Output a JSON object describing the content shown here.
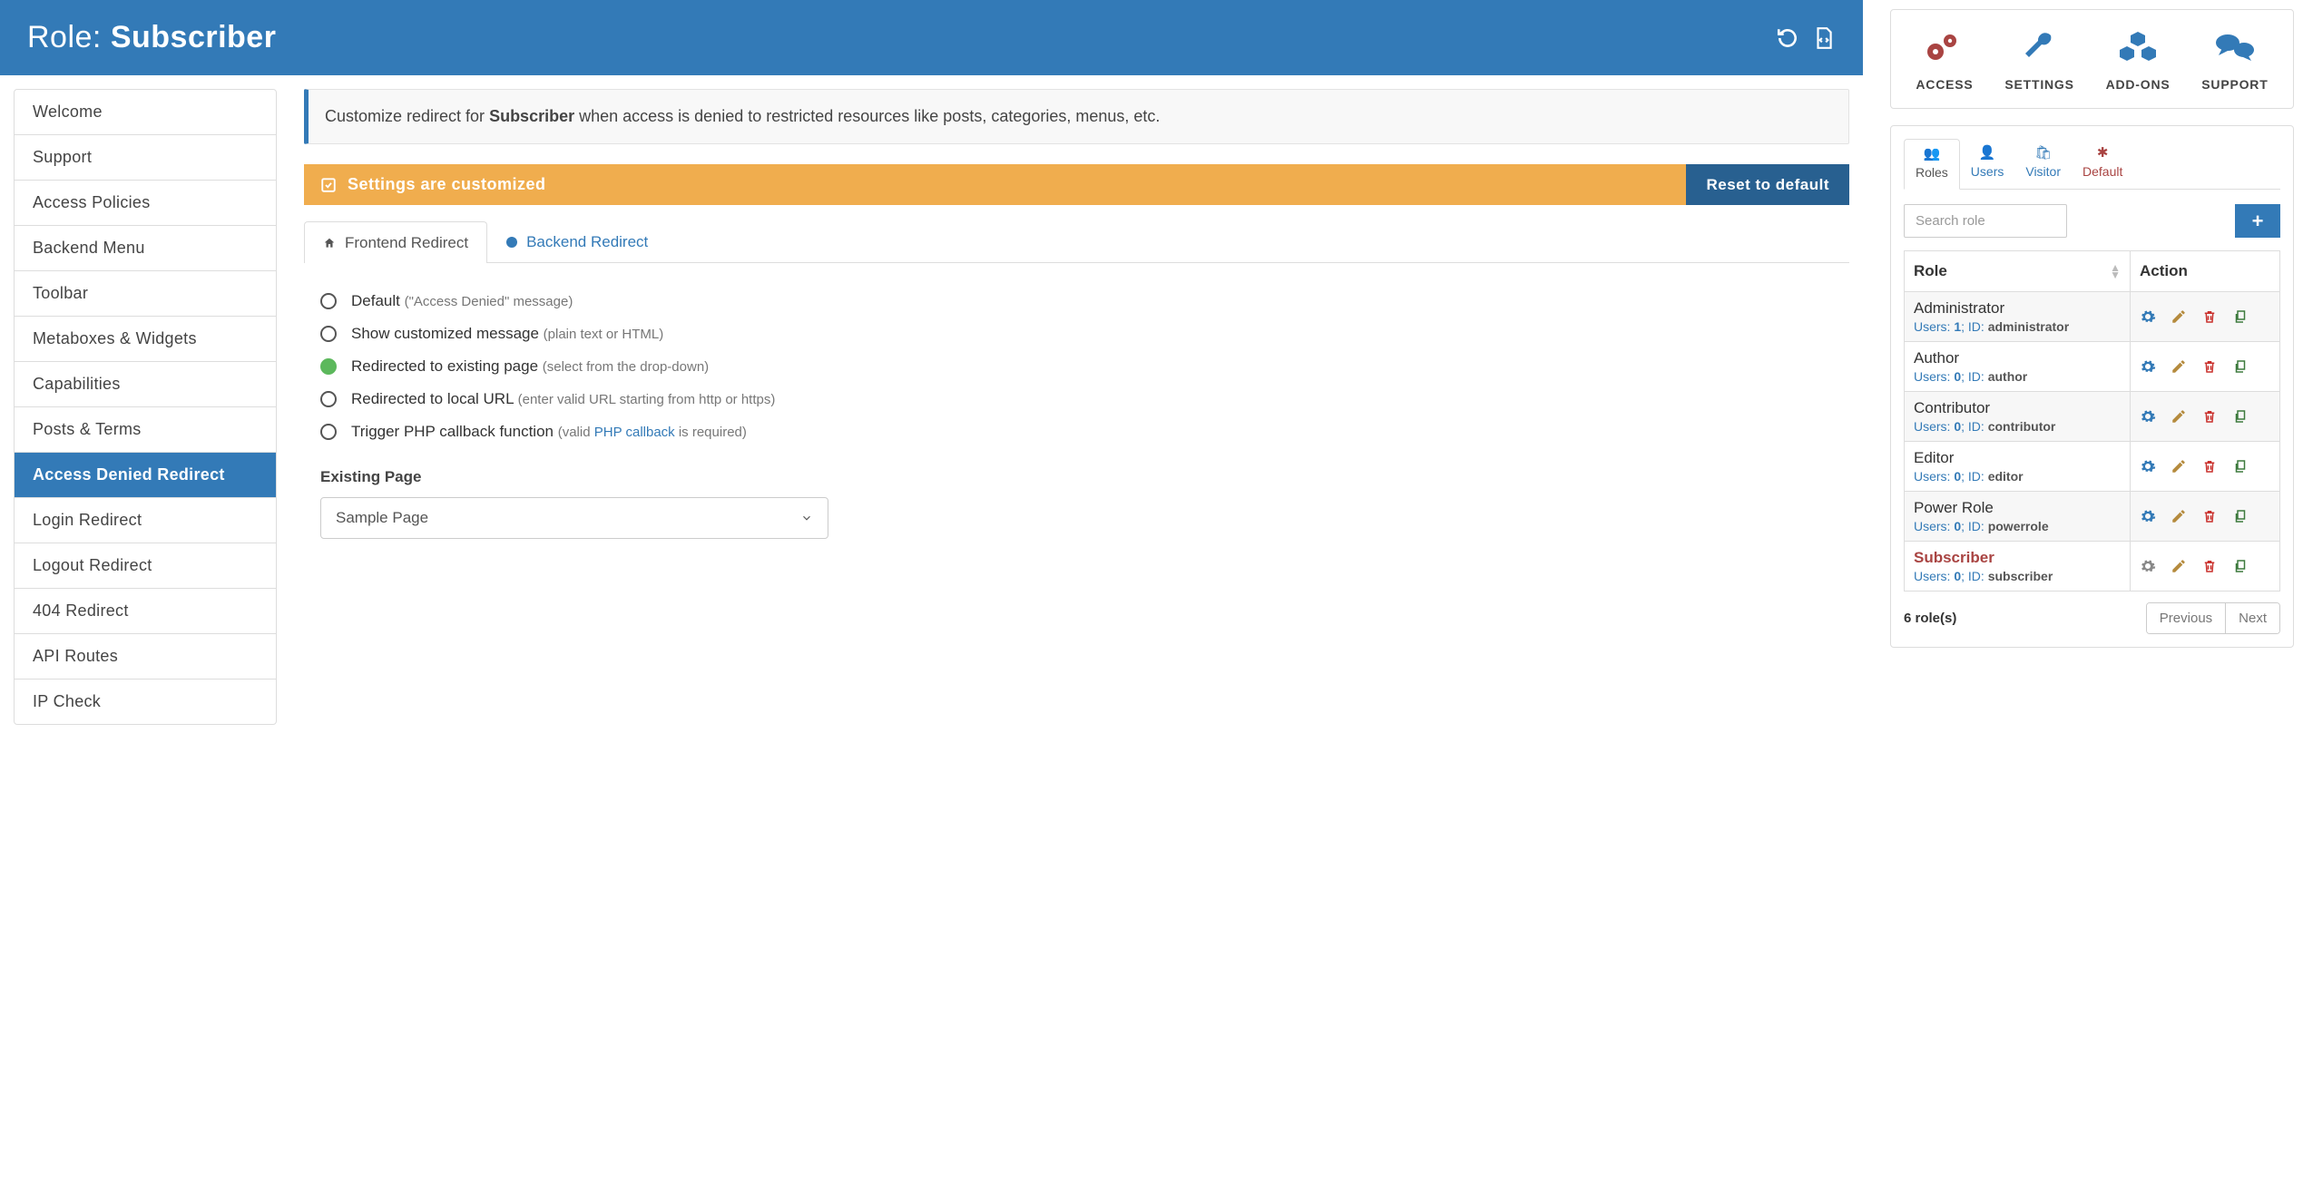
{
  "header": {
    "prefix": "Role:",
    "role": "Subscriber"
  },
  "sidebar": {
    "items": [
      {
        "label": "Welcome"
      },
      {
        "label": "Support"
      },
      {
        "label": "Access Policies"
      },
      {
        "label": "Backend Menu"
      },
      {
        "label": "Toolbar"
      },
      {
        "label": "Metaboxes & Widgets"
      },
      {
        "label": "Capabilities"
      },
      {
        "label": "Posts & Terms"
      },
      {
        "label": "Access Denied Redirect"
      },
      {
        "label": "Login Redirect"
      },
      {
        "label": "Logout Redirect"
      },
      {
        "label": "404 Redirect"
      },
      {
        "label": "API Routes"
      },
      {
        "label": "IP Check"
      }
    ],
    "active_index": 8
  },
  "info": {
    "pre": "Customize redirect for ",
    "role": "Subscriber",
    "post": " when access is denied to restricted resources like posts, categories, menus, etc."
  },
  "custom_bar": {
    "text": "Settings are customized",
    "reset": "Reset to default"
  },
  "tabs": {
    "frontend": "Frontend Redirect",
    "backend": "Backend Redirect"
  },
  "radios": {
    "opt0": {
      "label": "Default ",
      "hint": "(\"Access Denied\" message)"
    },
    "opt1": {
      "label": "Show customized message ",
      "hint": "(plain text or HTML)"
    },
    "opt2": {
      "label": "Redirected to existing page ",
      "hint": "(select from the drop-down)"
    },
    "opt3": {
      "label": "Redirected to local URL ",
      "hint": "(enter valid URL starting from http or https)"
    },
    "opt4": {
      "label": "Trigger PHP callback function ",
      "hint_pre": "(valid ",
      "hint_link": "PHP callback",
      "hint_post": " is required)"
    }
  },
  "existing_page": {
    "label": "Existing Page",
    "value": "Sample Page"
  },
  "topnav": {
    "access": "ACCESS",
    "settings": "SETTINGS",
    "addons": "ADD-ONS",
    "support": "SUPPORT"
  },
  "minitabs": {
    "roles": "Roles",
    "users": "Users",
    "visitor": "Visitor",
    "default": "Default"
  },
  "search": {
    "placeholder": "Search role"
  },
  "table": {
    "col_role": "Role",
    "col_action": "Action",
    "rows": [
      {
        "name": "Administrator",
        "users": "1",
        "id": "administrator"
      },
      {
        "name": "Author",
        "users": "0",
        "id": "author"
      },
      {
        "name": "Contributor",
        "users": "0",
        "id": "contributor"
      },
      {
        "name": "Editor",
        "users": "0",
        "id": "editor"
      },
      {
        "name": "Power Role",
        "users": "0",
        "id": "powerrole"
      },
      {
        "name": "Subscriber",
        "users": "0",
        "id": "subscriber"
      }
    ],
    "selected_index": 5,
    "count": "6 role(s)"
  },
  "pager": {
    "prev": "Previous",
    "next": "Next"
  },
  "meta": {
    "users_label": "Users:",
    "id_label": "ID:",
    "sep": "; "
  }
}
